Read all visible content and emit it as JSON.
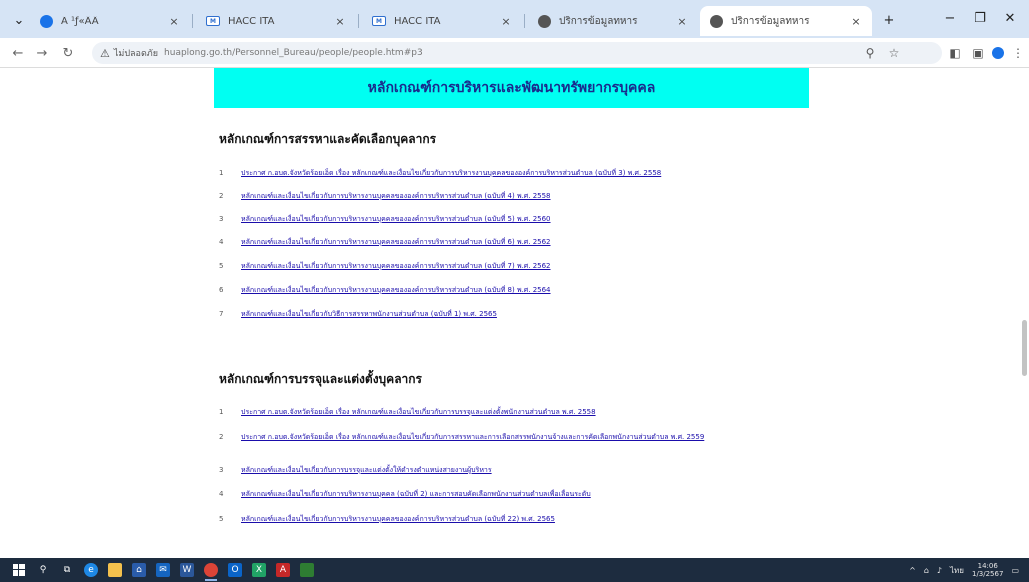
{
  "browser": {
    "tabs": [
      {
        "title": "Ã ¹ƒ«ÂÂ",
        "icon": "blue",
        "active": false
      },
      {
        "title": "HACC ITA",
        "icon": "mail",
        "active": false
      },
      {
        "title": "HACC ITA",
        "icon": "mail",
        "active": false
      },
      {
        "title": "ปริการข้อมูลทหาร",
        "icon": "gray",
        "active": false
      },
      {
        "title": "ปริการข้อมูลทหาร",
        "icon": "gray",
        "active": true
      }
    ],
    "address": {
      "security_label": "ไม่ปลอดภัย",
      "url": "huaplong.go.th/Personnel_Bureau/people/people.htm#p3"
    }
  },
  "page": {
    "banner_title": "หลักเกณฑ์การบริหารและพัฒนาทรัพยากรบุคคล",
    "sections": [
      {
        "title": "หลักเกณฑ์การสรรหาและคัดเลือกบุคลากร",
        "items": [
          {
            "num": "1",
            "text": "ประกาศ ก.อบต.จังหวัดร้อยเอ็ด เรื่อง หลักเกณฑ์และเงื่อนไขเกี่ยวกับการบริหารงานบุคคลขององค์การบริหารส่วนตำบล (ฉบับที่ 3) พ.ศ. 2558"
          },
          {
            "num": "2",
            "text": "หลักเกณฑ์และเงื่อนไขเกี่ยวกับการบริหารงานบุคคลขององค์การบริหารส่วนตำบล (ฉบับที่ 4) พ.ศ. 2558"
          },
          {
            "num": "3",
            "text": "หลักเกณฑ์และเงื่อนไขเกี่ยวกับการบริหารงานบุคคลขององค์การบริหารส่วนตำบล (ฉบับที่ 5) พ.ศ. 2560"
          },
          {
            "num": "4",
            "text": "หลักเกณฑ์และเงื่อนไขเกี่ยวกับการบริหารงานบุคคลขององค์การบริหารส่วนตำบล (ฉบับที่ 6) พ.ศ. 2562"
          },
          {
            "num": "5",
            "text": "หลักเกณฑ์และเงื่อนไขเกี่ยวกับการบริหารงานบุคคลขององค์การบริหารส่วนตำบล (ฉบับที่ 7) พ.ศ. 2562"
          },
          {
            "num": "6",
            "text": "หลักเกณฑ์และเงื่อนไขเกี่ยวกับการบริหารงานบุคคลขององค์การบริหารส่วนตำบล (ฉบับที่ 8) พ.ศ. 2564"
          },
          {
            "num": "7",
            "text": "หลักเกณฑ์และเงื่อนไขเกี่ยวกับวิธีการสรรหาพนักงานส่วนตำบล (ฉบับที่ 1) พ.ศ. 2565"
          }
        ]
      },
      {
        "title": "หลักเกณฑ์การบรรจุและแต่งตั้งบุคลากร",
        "items": [
          {
            "num": "1",
            "text": "ประกาศ ก.อบต.จังหวัดร้อยเอ็ด เรื่อง หลักเกณฑ์และเงื่อนไขเกี่ยวกับการบรรจุและแต่งตั้งพนักงานส่วนตำบล พ.ศ. 2558"
          },
          {
            "num": "2",
            "text": "ประกาศ ก.อบต.จังหวัดร้อยเอ็ด เรื่อง หลักเกณฑ์และเงื่อนไขเกี่ยวกับการสรรหาและการเลือกสรรพนักงานจ้างและการคัดเลือกพนักงานส่วนตำบล พ.ศ. 2559"
          },
          {
            "num": "3",
            "text": "หลักเกณฑ์และเงื่อนไขเกี่ยวกับการบรรจุและแต่งตั้งให้ดำรงตำแหน่งสายงานผู้บริหาร"
          },
          {
            "num": "4",
            "text": "หลักเกณฑ์และเงื่อนไขเกี่ยวกับการบริหารงานบุคคล (ฉบับที่ 2) และการสอบคัดเลือกพนักงานส่วนตำบลเพื่อเลื่อนระดับ"
          },
          {
            "num": "5",
            "text": "หลักเกณฑ์และเงื่อนไขเกี่ยวกับการบริหารงานบุคคลขององค์การบริหารส่วนตำบล (ฉบับที่ 22) พ.ศ. 2565"
          }
        ]
      }
    ]
  },
  "taskbar": {
    "apps": [
      "windows",
      "search",
      "task-view",
      "edge",
      "file-explorer",
      "store",
      "mail",
      "word",
      "chrome",
      "outlook",
      "excel",
      "acrobat",
      "app"
    ],
    "tray": {
      "lang": "ไทย",
      "time": "14:06",
      "date": "1/3/2567"
    }
  }
}
